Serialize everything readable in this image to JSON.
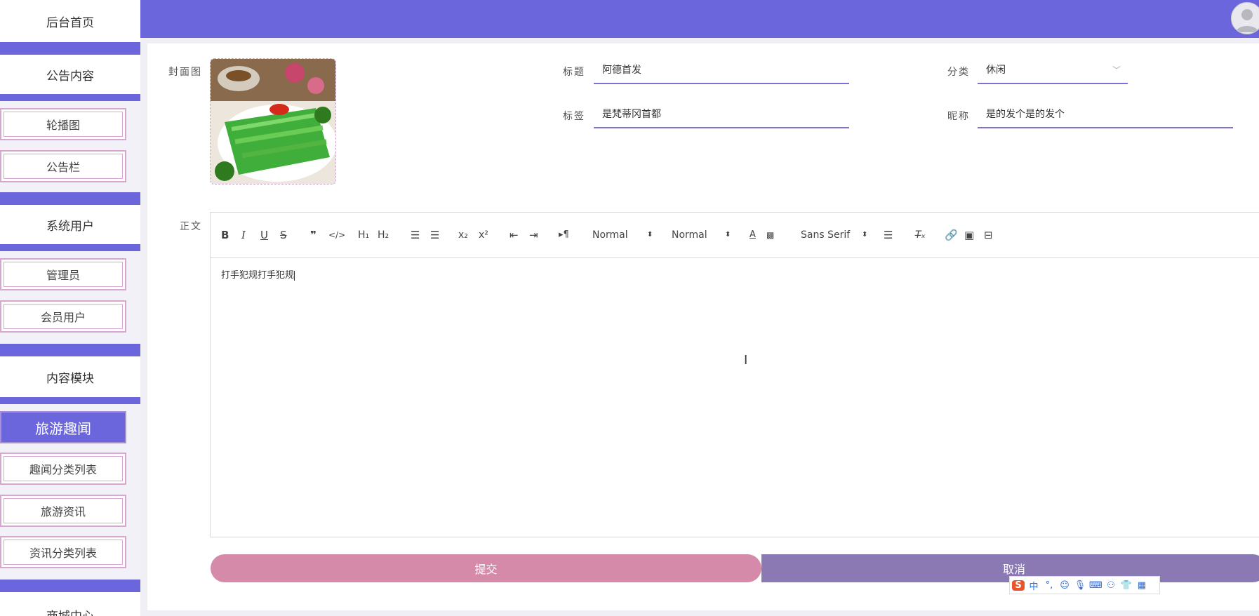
{
  "sidebar": {
    "home": "后台首页",
    "groups": [
      {
        "title": "公告内容",
        "items": [
          "轮播图",
          "公告栏"
        ]
      },
      {
        "title": "系统用户",
        "items": [
          "管理员",
          "会员用户"
        ]
      },
      {
        "title": "内容模块",
        "items": [
          "旅游趣闻",
          "趣闻分类列表",
          "旅游资讯",
          "资讯分类列表"
        ]
      },
      {
        "title": "商城中心",
        "items": []
      }
    ],
    "active_item": "旅游趣闻"
  },
  "header": {
    "avatar_icon": "user-avatar-icon"
  },
  "form": {
    "cover_label": "封面图",
    "title_label": "标题",
    "title_value": "阿德首发",
    "category_label": "分类",
    "category_value": "休闲",
    "tag_label": "标签",
    "tag_value": "是梵蒂冈首都",
    "nickname_label": "昵称",
    "nickname_value": "是的发个是的发个",
    "body_label": "正文"
  },
  "editor": {
    "toolbar": {
      "bold": "B",
      "italic": "I",
      "underline": "U",
      "strike": "S",
      "quote": "❞",
      "code": "</>",
      "h1": "H₁",
      "h2": "H₂",
      "ordered_list": "☰",
      "bullet_list": "☰",
      "sub": "x₂",
      "sup": "x²",
      "outdent": "⇤",
      "indent": "⇥",
      "direction": "▸¶",
      "size_select": "Normal",
      "header_select": "Normal",
      "font_select": "Sans Serif"
    },
    "content": "打手犯规打手犯规"
  },
  "buttons": {
    "submit": "提交",
    "cancel": "取消"
  },
  "ime": {
    "logo": "S",
    "lang": "中"
  },
  "colors": {
    "primary": "#6b66db",
    "submit": "#d68aa9",
    "cancel": "#8b79b4",
    "border": "#d6a7cf"
  }
}
